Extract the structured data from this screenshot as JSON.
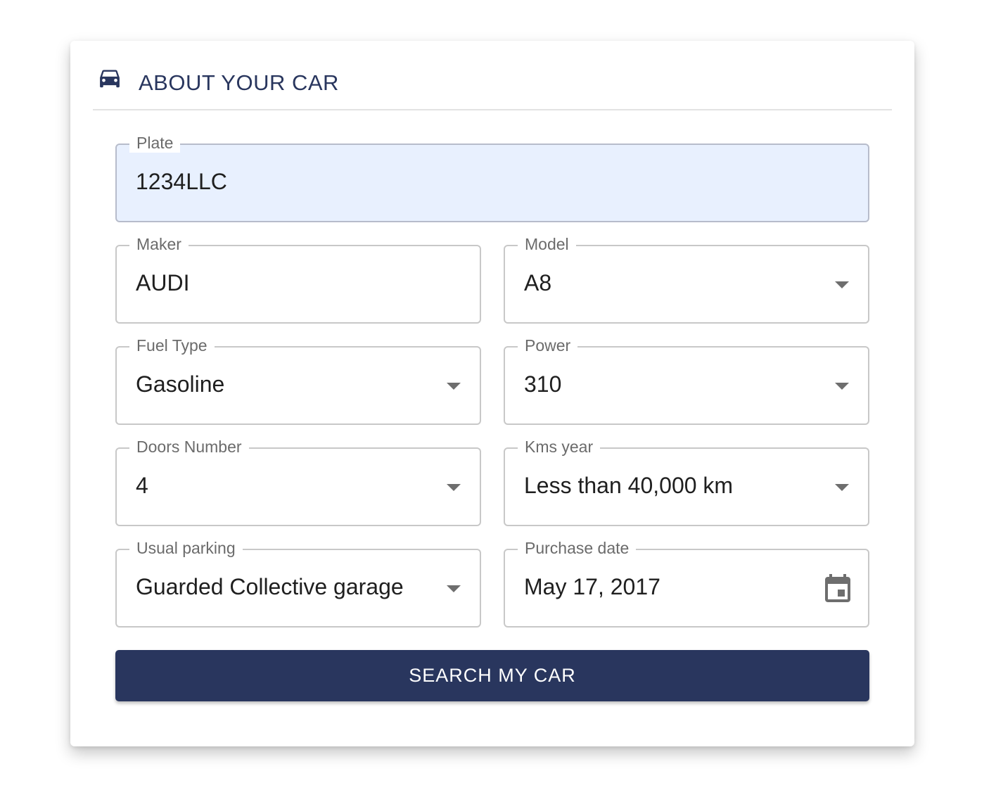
{
  "header": {
    "icon": "car-icon",
    "title": "ABOUT YOUR CAR",
    "color": "#29365e"
  },
  "fields": {
    "plate": {
      "label": "Plate",
      "value": "1234LLC"
    },
    "maker": {
      "label": "Maker",
      "value": "AUDI"
    },
    "model": {
      "label": "Model",
      "value": "A8",
      "icon": "chevron-down-icon"
    },
    "fuel_type": {
      "label": "Fuel Type",
      "value": "Gasoline",
      "icon": "chevron-down-icon"
    },
    "power": {
      "label": "Power",
      "value": "310",
      "icon": "chevron-down-icon"
    },
    "doors_number": {
      "label": "Doors Number",
      "value": "4",
      "icon": "chevron-down-icon"
    },
    "kms_year": {
      "label": "Kms year",
      "value": "Less than 40,000 km",
      "icon": "chevron-down-icon"
    },
    "usual_parking": {
      "label": "Usual parking",
      "value": "Guarded Collective garage",
      "icon": "chevron-down-icon"
    },
    "purchase_date": {
      "label": "Purchase date",
      "value": "May 17, 2017",
      "icon": "calendar-icon"
    }
  },
  "actions": {
    "search_label": "SEARCH MY CAR",
    "button_color": "#29365e"
  },
  "colors": {
    "autofill_background": "#e8f0fe",
    "field_border": "#c8c8c8",
    "label_text": "#6b6b6b"
  }
}
